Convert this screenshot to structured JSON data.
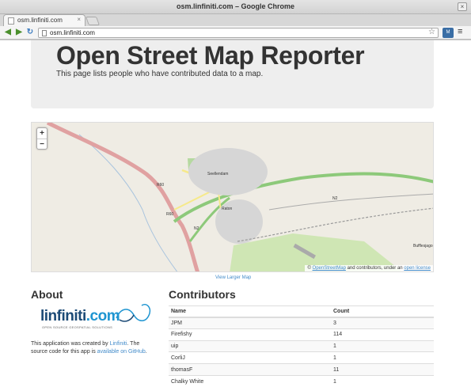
{
  "window": {
    "title": "osm.linfiniti.com – Google Chrome"
  },
  "tab": {
    "title": "osm.linfiniti.com",
    "close": "×"
  },
  "toolbar": {
    "url": "osm.linfiniti.com",
    "back": "◀",
    "forward": "▶",
    "reload": "↻",
    "star": "☆",
    "menu": "≡",
    "ext_label": "M"
  },
  "header": {
    "title": "Open Street Map Reporter",
    "subtitle": "This page lists people who have contributed data to a map."
  },
  "map": {
    "zoom_in": "+",
    "zoom_out": "−",
    "labels": [
      "Seellendam",
      "Raton",
      "R60",
      "R60",
      "N2",
      "N2",
      "Bufflesjago"
    ],
    "attribution": {
      "prefix": "©",
      "osm_link": "OpenStreetMap",
      "middle": " and contributors, under an ",
      "license_link": "open license"
    },
    "view_larger": "View Larger Map"
  },
  "about": {
    "heading": "About",
    "logo_word_main": "linfiniti",
    "logo_word_suffix": ".com",
    "logo_tagline": "OPEN SOURCE GEOSPATIAL SOLUTIONS",
    "text_1": "This application was created by ",
    "link_1": "Linfiniti",
    "text_2": ". The source code for this app is ",
    "link_2": "available on GitHub",
    "text_3": "."
  },
  "contributors": {
    "heading": "Contributors",
    "columns": [
      "Name",
      "Count"
    ],
    "rows": [
      [
        "JPM",
        "3"
      ],
      [
        "Firefishy",
        "114"
      ],
      [
        "uip",
        "1"
      ],
      [
        "CorliJ",
        "1"
      ],
      [
        "thomasF",
        "11"
      ],
      [
        "Chalky White",
        "1"
      ]
    ]
  }
}
